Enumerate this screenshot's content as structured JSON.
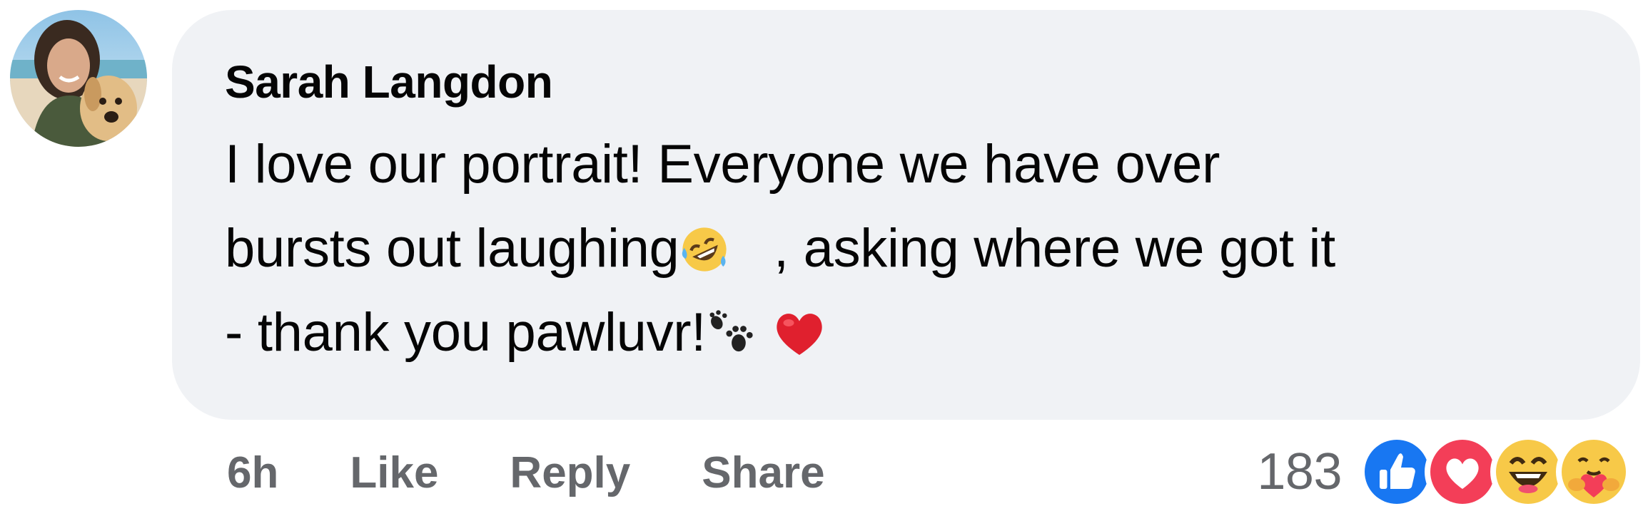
{
  "comment": {
    "author": "Sarah Langdon",
    "text_lines": [
      "I love our portrait! Everyone we have over",
      "bursts out laughing",
      ", asking where we got it",
      "- thank you pawluvr!"
    ],
    "emojis": [
      "rolling-on-floor-laughing-emoji",
      "paw-prints-emoji",
      "red-heart-emoji"
    ]
  },
  "actions": {
    "timestamp": "6h",
    "like_label": "Like",
    "reply_label": "Reply",
    "share_label": "Share"
  },
  "reactions": {
    "count": "183",
    "types": [
      "like-reaction-icon",
      "love-reaction-icon",
      "haha-reaction-icon",
      "care-reaction-icon"
    ]
  },
  "colors": {
    "bubble_bg": "#f0f2f5",
    "secondary_text": "#65676b",
    "like_blue": "#1877f2",
    "love_red": "#f33e58",
    "emoji_yellow": "#f7c948"
  }
}
